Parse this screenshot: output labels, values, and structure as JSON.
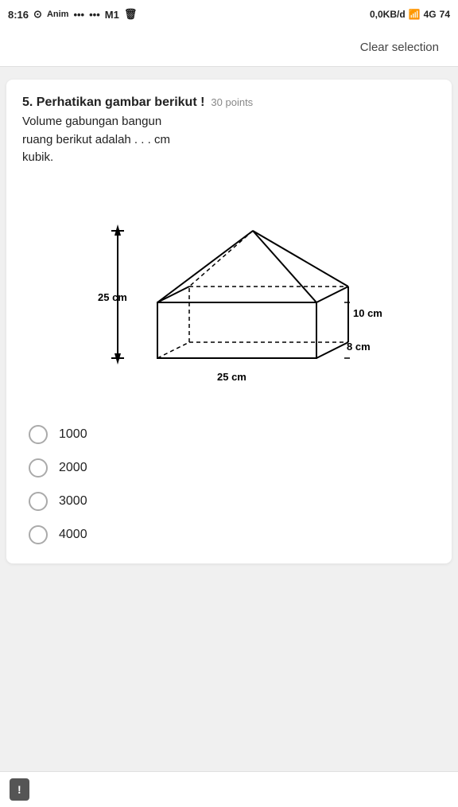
{
  "statusBar": {
    "time": "8:16",
    "network": "0,0KB/d",
    "carrier": "4G",
    "battery": "74"
  },
  "topBar": {
    "clearSelection": "Clear selection"
  },
  "question": {
    "number": "5.",
    "title": "Perhatikan gambar berikut !",
    "points": "30 points",
    "bodyLine1": "Volume gabungan bangun",
    "bodyLine2": "ruang berikut adalah . . . cm",
    "bodyLine3": "kubik."
  },
  "diagram": {
    "label25cmLeft": "25 cm",
    "label10cm": "10 cm",
    "label8cm": "8 cm",
    "label25cmBottom": "25 cm"
  },
  "options": [
    {
      "id": "opt1",
      "value": "1000",
      "label": "1000"
    },
    {
      "id": "opt2",
      "value": "2000",
      "label": "2000"
    },
    {
      "id": "opt3",
      "value": "3000",
      "label": "3000"
    },
    {
      "id": "opt4",
      "value": "4000",
      "label": "4000"
    }
  ],
  "bottomBar": {
    "helpLabel": "!"
  }
}
